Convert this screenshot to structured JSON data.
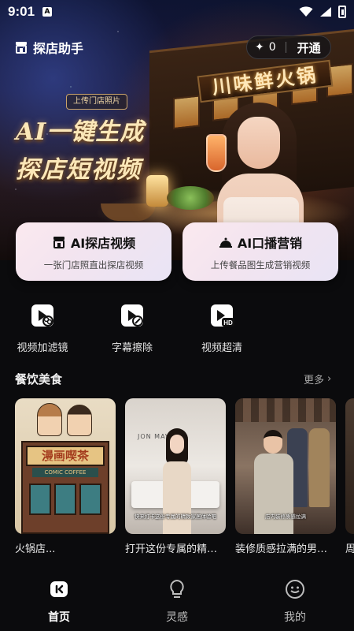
{
  "status_bar": {
    "time": "9:01",
    "notification_badge": "A"
  },
  "header": {
    "app_title": "探店助手",
    "credits_count": "0",
    "open_label": "开通"
  },
  "hero": {
    "upload_tag": "上传门店照片",
    "headline_line1": "AI一键生成",
    "headline_line2": "探店短视频",
    "restaurant_sign": "川味鲜火锅"
  },
  "feature_cards": [
    {
      "title": "AI探店视频",
      "subtitle": "一张门店照直出探店视频",
      "icon": "store-icon"
    },
    {
      "title": "AI口播营销",
      "subtitle": "上传餐品图生成营销视频",
      "icon": "cloche-icon"
    }
  ],
  "tools": [
    {
      "label": "视频加滤镜",
      "icon": "video-filter-icon"
    },
    {
      "label": "字幕擦除",
      "icon": "subtitle-erase-icon"
    },
    {
      "label": "视频超清",
      "icon": "video-hd-icon",
      "badge": "HD"
    }
  ],
  "section": {
    "title": "餐饮美食",
    "more_label": "更多"
  },
  "thumbnails": [
    {
      "caption": "火锅店...",
      "sign_text": "漫画喫茶",
      "sign_sub": "COMIC COFFEE",
      "sign_sub2": "漫画咖啡 ROASTERY"
    },
    {
      "caption": "打开这份专属的精致...",
      "logo": "JON MAVIN",
      "subtitle": "快来打卡这份专属的精致家居体验吧"
    },
    {
      "caption": "装修质感拉满的男装店",
      "subtitle": "店内装修质感拉满"
    },
    {
      "caption": "周"
    }
  ],
  "bottom_nav": [
    {
      "label": "首页",
      "icon": "home-icon",
      "active": true
    },
    {
      "label": "灵感",
      "icon": "lightbulb-icon",
      "active": false
    },
    {
      "label": "我的",
      "icon": "profile-icon",
      "active": false
    }
  ]
}
